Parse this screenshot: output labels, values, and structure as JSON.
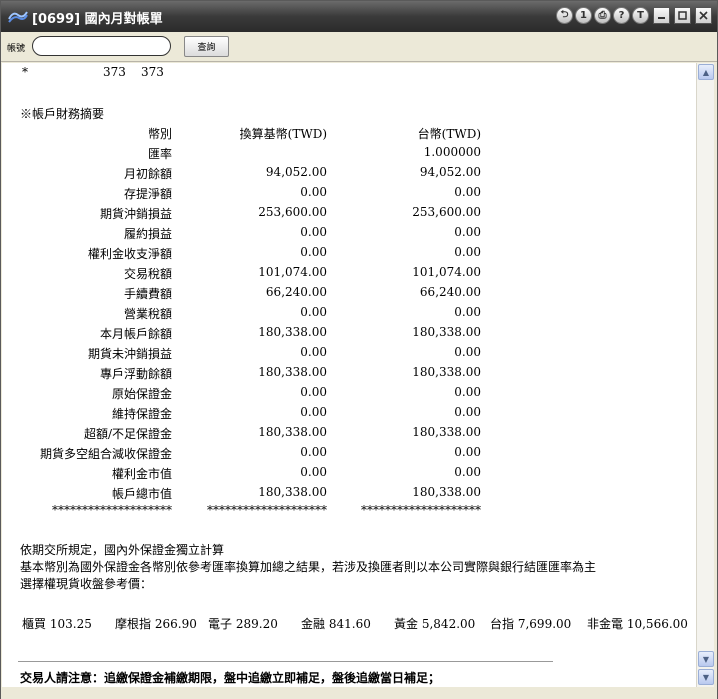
{
  "window": {
    "title": "[0699] 國內月對帳單",
    "title_buttons": [
      "⮌",
      "1",
      "⎙",
      "?",
      "T"
    ]
  },
  "toolbar": {
    "account_label": "帳號",
    "account_value": "",
    "query_button": "查詢"
  },
  "top_row": {
    "mark": "*",
    "val1": "373",
    "val2": "373"
  },
  "summary": {
    "section_title": "※帳戶財務摘要",
    "header": {
      "label": "幣別",
      "col1": "換算基幣(TWD)",
      "col2": "台幣(TWD)"
    },
    "rows": [
      {
        "label": "匯率",
        "col1": "",
        "col2": "1.000000"
      },
      {
        "label": "月初餘額",
        "col1": "94,052.00",
        "col2": "94,052.00"
      },
      {
        "label": "存提淨額",
        "col1": "0.00",
        "col2": "0.00"
      },
      {
        "label": "期貨沖銷損益",
        "col1": "253,600.00",
        "col2": "253,600.00"
      },
      {
        "label": "履約損益",
        "col1": "0.00",
        "col2": "0.00"
      },
      {
        "label": "權利金收支淨額",
        "col1": "0.00",
        "col2": "0.00"
      },
      {
        "label": "交易稅額",
        "col1": "101,074.00",
        "col2": "101,074.00"
      },
      {
        "label": "手續費額",
        "col1": "66,240.00",
        "col2": "66,240.00"
      },
      {
        "label": "營業稅額",
        "col1": "0.00",
        "col2": "0.00"
      },
      {
        "label": "本月帳戶餘額",
        "col1": "180,338.00",
        "col2": "180,338.00"
      },
      {
        "label": "期貨未沖銷損益",
        "col1": "0.00",
        "col2": "0.00"
      },
      {
        "label": "專戶浮動餘額",
        "col1": "180,338.00",
        "col2": "180,338.00"
      },
      {
        "label": "原始保證金",
        "col1": "0.00",
        "col2": "0.00"
      },
      {
        "label": "維持保證金",
        "col1": "0.00",
        "col2": "0.00"
      },
      {
        "label": "超額/不足保證金",
        "col1": "180,338.00",
        "col2": "180,338.00"
      },
      {
        "label": "期貨多空組合減收保證金",
        "col1": "0.00",
        "col2": "0.00"
      },
      {
        "label": "權利金市值",
        "col1": "0.00",
        "col2": "0.00"
      },
      {
        "label": "帳戶總市值",
        "col1": "180,338.00",
        "col2": "180,338.00"
      }
    ],
    "separator": "********************"
  },
  "notes": [
    "依期交所規定，國內外保證金獨立計算",
    "基本幣別為國外保證金各幣別依參考匯率換算加總之結果，若涉及換匯者則以本公司實際與銀行結匯匯率為主",
    "選擇權現貨收盤參考價："
  ],
  "reference_prices": [
    {
      "name": "櫃買",
      "value": "103.25"
    },
    {
      "name": "摩根指",
      "value": "266.90"
    },
    {
      "name": "電子",
      "value": "289.20"
    },
    {
      "name": "金融",
      "value": "841.60"
    },
    {
      "name": "黃金",
      "value": "5,842.00"
    },
    {
      "name": "台指",
      "value": "7,699.00"
    },
    {
      "name": "非金電",
      "value": "10,566.00"
    }
  ],
  "footer_notice": "交易人請注意：追繳保證金補繳期限，盤中追繳立即補足，盤後追繳當日補足；",
  "colors": {
    "titlebar": "#2b2b2b",
    "content_bg": "#ffffff",
    "window_bg": "#ece9d8"
  }
}
